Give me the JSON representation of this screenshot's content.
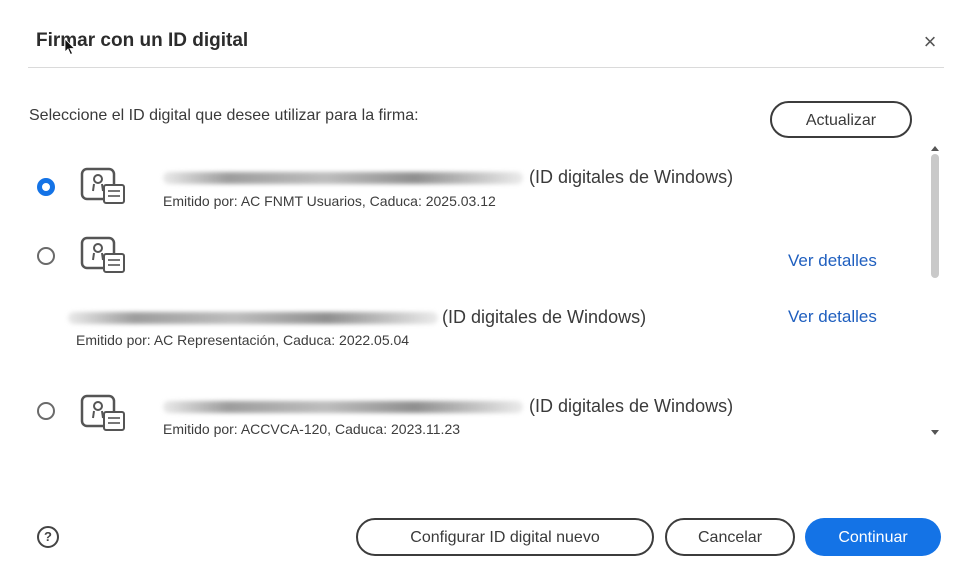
{
  "dialog": {
    "title": "Firmar con un ID digital",
    "close_glyph": "×",
    "prompt": "Seleccione el ID digital que desee utilizar para la firma:",
    "update_label": "Actualizar"
  },
  "ids": [
    {
      "selected": true,
      "source": "(ID digitales de Windows)",
      "issuer": "Emitido por: AC FNMT Usuarios, Caduca: 2025.03.12",
      "icon": "certificate-icon"
    },
    {
      "selected": false,
      "source": "(ID digitales de Windows)",
      "issuer": "Emitido por: AC Representación, Caduca: 2022.05.04",
      "details_label": "Ver detalles",
      "icon": "certificate-icon"
    },
    {
      "selected": false,
      "source": "(ID digitales de Windows)",
      "issuer": "Emitido por: ACCVCA-120, Caduca: 2023.11.23",
      "icon": "certificate-icon"
    }
  ],
  "details_label_top": "Ver detalles",
  "footer": {
    "help_glyph": "?",
    "configure_label": "Configurar ID digital nuevo",
    "cancel_label": "Cancelar",
    "continue_label": "Continuar"
  },
  "colors": {
    "accent": "#1473e6",
    "link": "#1f5fbf"
  }
}
